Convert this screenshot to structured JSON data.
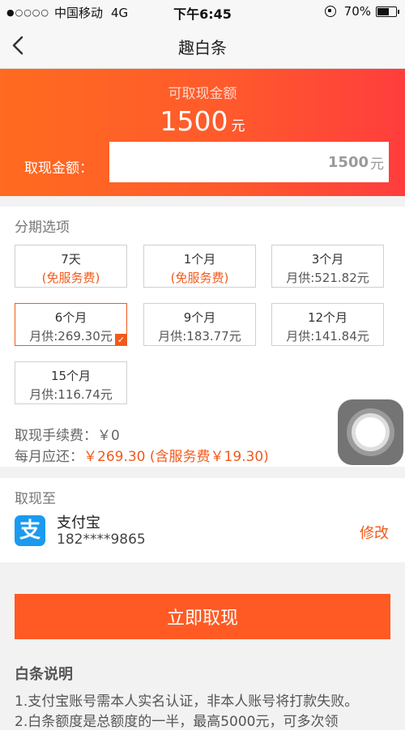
{
  "status_bar": {
    "signal_dots": "●○○○○",
    "carrier": "中国移动",
    "network": "4G",
    "time": "下午6:45",
    "battery": "70%",
    "battery_level": 0.7
  },
  "nav": {
    "title": "趣白条"
  },
  "hero": {
    "label": "可取现金额",
    "amount": "1500",
    "unit": "元",
    "withdraw_label": "取现金额：",
    "withdraw_value": "1500",
    "withdraw_unit": "元"
  },
  "installment": {
    "title": "分期选项",
    "options": [
      {
        "name": "7天",
        "sub": "(免服务费)"
      },
      {
        "name": "1个月",
        "sub": "(免服务费)"
      },
      {
        "name": "3个月",
        "sub": "月供:521.82元"
      },
      {
        "name": "6个月",
        "sub": "月供:269.30元"
      },
      {
        "name": "9个月",
        "sub": "月供:183.77元"
      },
      {
        "name": "12个月",
        "sub": "月供:141.84元"
      },
      {
        "name": "15个月",
        "sub": "月供:116.74元"
      }
    ],
    "check_mark": "✓",
    "fee_label": "取现手续费：",
    "fee_value": "￥0",
    "monthly_label": "每月应还：",
    "monthly_value": "￥269.30 (含服务费￥19.30)"
  },
  "destination": {
    "title": "取现至",
    "icon_glyph": "支",
    "name": "支付宝",
    "account": "182****9865",
    "modify": "修改"
  },
  "cta": {
    "label": "立即取现"
  },
  "notes": {
    "title": "白条说明",
    "items": [
      "1.支付宝账号需本人实名认证，非本人账号将打款失败。",
      "2.白条额度是总额度的一半，最高5000元，可多次领"
    ]
  },
  "colors": {
    "accent": "#f25a1b",
    "alipay": "#1b9af0"
  }
}
